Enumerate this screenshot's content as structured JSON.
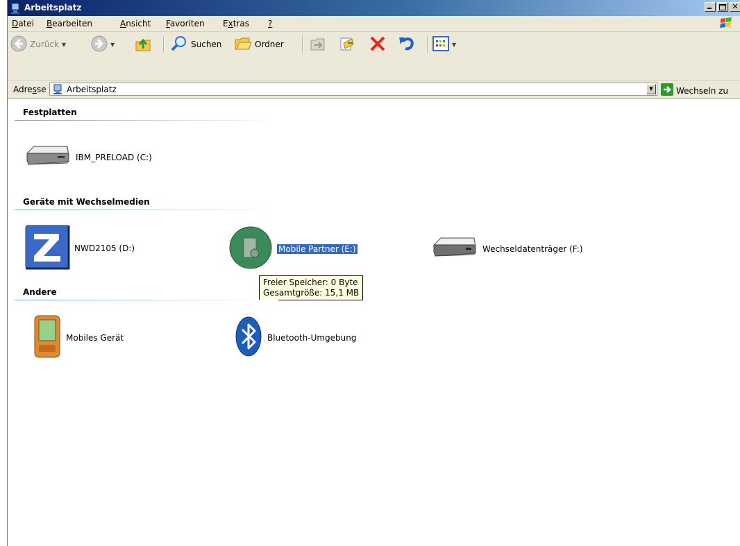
{
  "window": {
    "title": "Arbeitsplatz"
  },
  "menu": [
    {
      "pre": "",
      "key": "D",
      "post": "atei"
    },
    {
      "pre": "",
      "key": "B",
      "post": "earbeiten"
    },
    {
      "pre": "",
      "key": "A",
      "post": "nsicht"
    },
    {
      "pre": "",
      "key": "F",
      "post": "avoriten"
    },
    {
      "pre": "E",
      "key": "x",
      "post": "tras"
    },
    {
      "pre": "",
      "key": "?",
      "post": ""
    }
  ],
  "toolbar": {
    "back_label": "Zurück",
    "search_label": "Suchen",
    "folders_label": "Ordner"
  },
  "address": {
    "label_pre": "Adre",
    "label_key": "s",
    "label_post": "se",
    "value": "Arbeitsplatz",
    "go_label": "Wechseln zu"
  },
  "groups": {
    "hard_disks": {
      "title": "Festplatten",
      "items": [
        {
          "name": "IBM_PRELOAD (C:)",
          "icon": "hard-disk-icon"
        }
      ]
    },
    "removable": {
      "title": "Geräte mit Wechselmedien",
      "items": [
        {
          "name": "NWD2105 (D:)",
          "icon": "zip-drive-icon"
        },
        {
          "name": "Mobile Partner (E:)",
          "icon": "mobile-partner-icon",
          "selected": true
        },
        {
          "name": "Wechseldatenträger (F:)",
          "icon": "removable-drive-icon"
        }
      ]
    },
    "other": {
      "title": "Andere",
      "items": [
        {
          "name": "Mobiles Gerät",
          "icon": "pda-icon"
        },
        {
          "name": "Bluetooth-Umgebung",
          "icon": "bluetooth-icon"
        }
      ]
    }
  },
  "tooltip": {
    "line1": "Freier Speicher: 0 Byte",
    "line2": "Gesamtgröße: 15,1 MB"
  },
  "colors": {
    "selection": "#316ac5",
    "title_bar": "#0a246a",
    "chrome": "#ece9d8"
  }
}
